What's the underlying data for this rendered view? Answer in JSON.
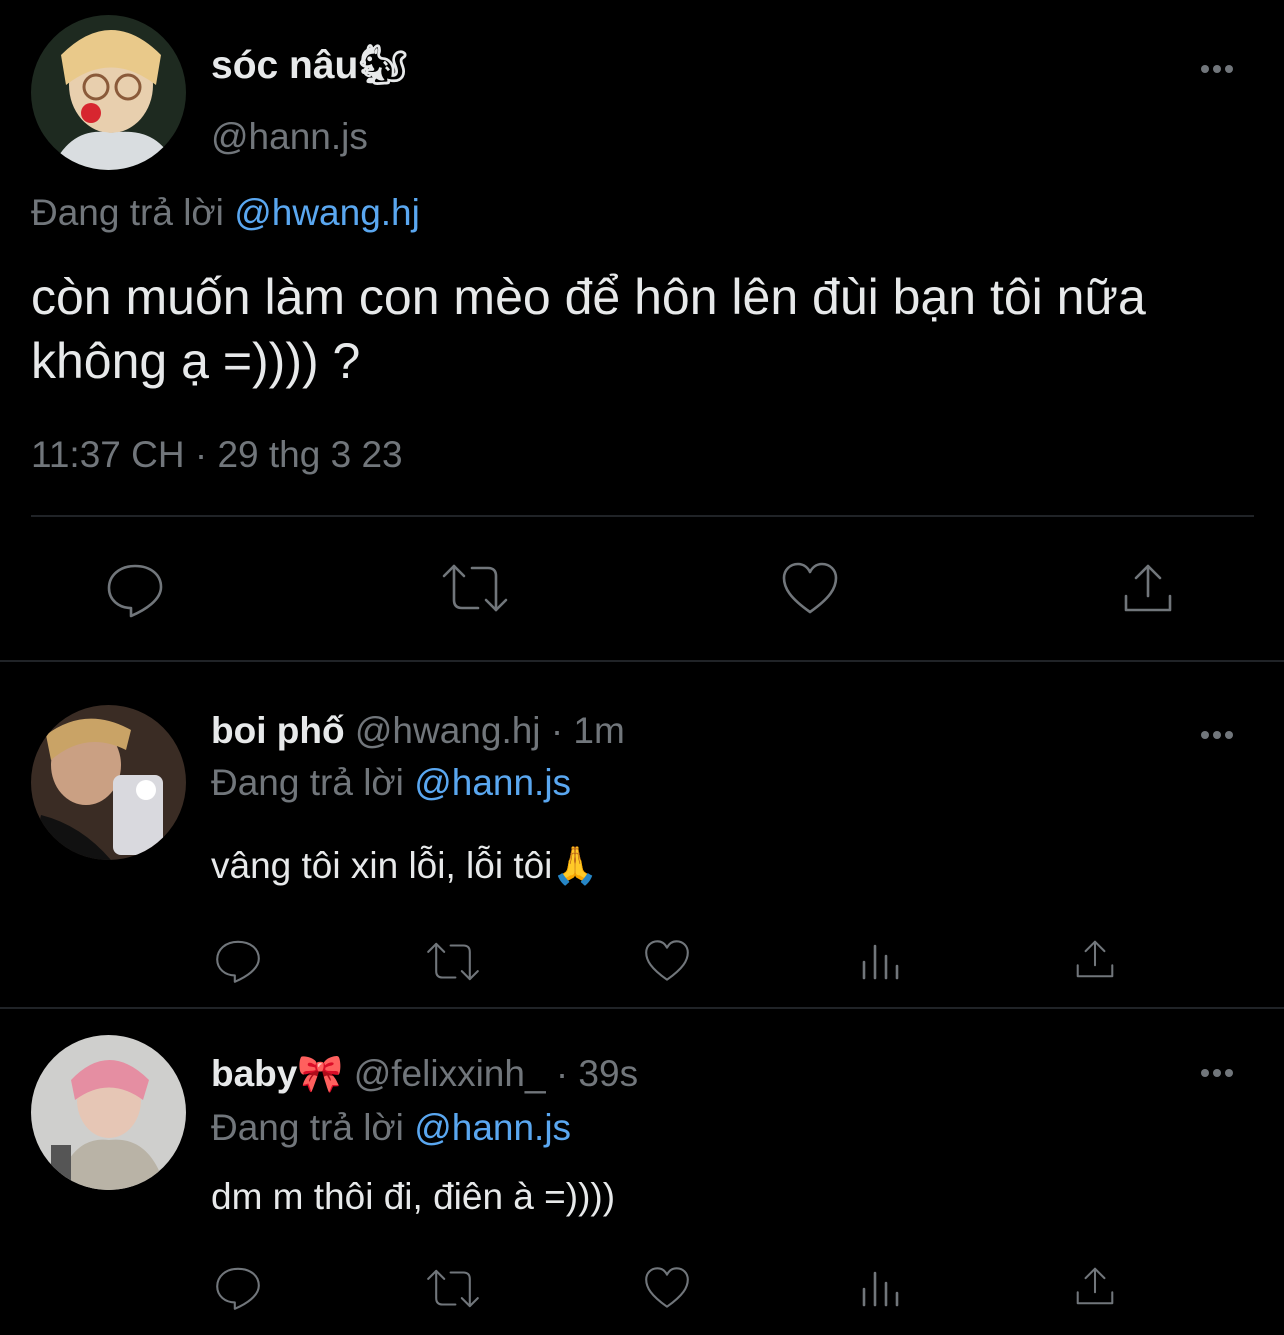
{
  "main_tweet": {
    "display_name": "sóc nâu",
    "name_emoji": "🐿",
    "handle": "@hann.js",
    "replying_prefix": "Đang trả lời",
    "replying_to": "@hwang.hj",
    "text": "còn muốn làm con mèo để hôn lên đùi bạn tôi nữa không ạ =)))) ?",
    "timestamp": "11:37 CH · 29 thg 3 23"
  },
  "replies": [
    {
      "display_name": "boi phố",
      "handle": "@hwang.hj",
      "time": "· 1m",
      "replying_prefix": "Đang trả lời",
      "replying_to": "@hann.js",
      "text": "vâng tôi xin lỗi, lỗi tôi",
      "text_emoji": "🙏"
    },
    {
      "display_name": "baby",
      "name_emoji": "🎀",
      "handle": "@felixxinh_",
      "time": "· 39s",
      "replying_prefix": "Đang trả lời",
      "replying_to": "@hann.js",
      "text": "dm m thôi đi, điên à =))))"
    }
  ],
  "icons": [
    "reply-icon",
    "retweet-icon",
    "like-icon",
    "views-icon",
    "share-icon",
    "more-icon"
  ],
  "colors": {
    "background": "#000000",
    "text": "#e7e9ea",
    "muted": "#71767b",
    "link": "#5aa7f0",
    "divider": "#202327"
  }
}
